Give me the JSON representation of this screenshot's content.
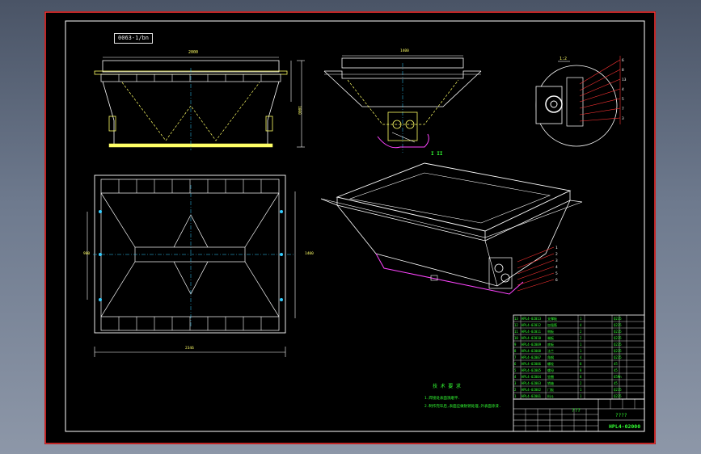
{
  "drawing": {
    "stamp_code": "0063-1/bn",
    "number": "HPL4-02000",
    "title_text": "???",
    "subtitle_text": "????",
    "section_marker": "A-A",
    "view_marker": "1:2",
    "iso_label": "I II",
    "notes_title": "技 术 要 求",
    "notes": [
      "1.焊接处表面须磨平.",
      "2.制作完毕后,表面应做防锈处理,外表面涂漆."
    ]
  },
  "bom": {
    "rows": [
      {
        "no": "13",
        "code": "HPL4-02013",
        "name": "支撑板",
        "qty": "1",
        "mat": "Q235"
      },
      {
        "no": "12",
        "code": "HPL4-02012",
        "name": "加强筋",
        "qty": "4",
        "mat": "Q235"
      },
      {
        "no": "11",
        "code": "HPL4-02011",
        "name": "侧板",
        "qty": "2",
        "mat": "Q235"
      },
      {
        "no": "10",
        "code": "HPL4-02010",
        "name": "端板",
        "qty": "2",
        "mat": "Q235"
      },
      {
        "no": "9",
        "code": "HPL4-02009",
        "name": "底板",
        "qty": "1",
        "mat": "Q235"
      },
      {
        "no": "8",
        "code": "HPL4-02008",
        "name": "法兰",
        "qty": "1",
        "mat": "Q235"
      },
      {
        "no": "7",
        "code": "HPL4-02007",
        "name": "角钢",
        "qty": "4",
        "mat": "Q235"
      },
      {
        "no": "6",
        "code": "HPL4-02006",
        "name": "螺栓",
        "qty": "8",
        "mat": "45"
      },
      {
        "no": "5",
        "code": "HPL4-02005",
        "name": "螺母",
        "qty": "8",
        "mat": "45"
      },
      {
        "no": "4",
        "code": "HPL4-02004",
        "name": "垫圈",
        "qty": "8",
        "mat": "65Mn"
      },
      {
        "no": "3",
        "code": "HPL4-02003",
        "name": "销轴",
        "qty": "2",
        "mat": "45"
      },
      {
        "no": "2",
        "code": "HPL4-02002",
        "name": "门板",
        "qty": "1",
        "mat": "Q235"
      },
      {
        "no": "1",
        "code": "HPL4-02001",
        "name": "料斗",
        "qty": "1",
        "mat": "Q235"
      }
    ]
  },
  "colors": {
    "paper": "#000000",
    "line": "#ffffff",
    "yellow": "#ffff66",
    "green": "#33ff33",
    "cyan": "#33ccff",
    "magenta": "#ff44ff",
    "red": "#ff3333"
  }
}
